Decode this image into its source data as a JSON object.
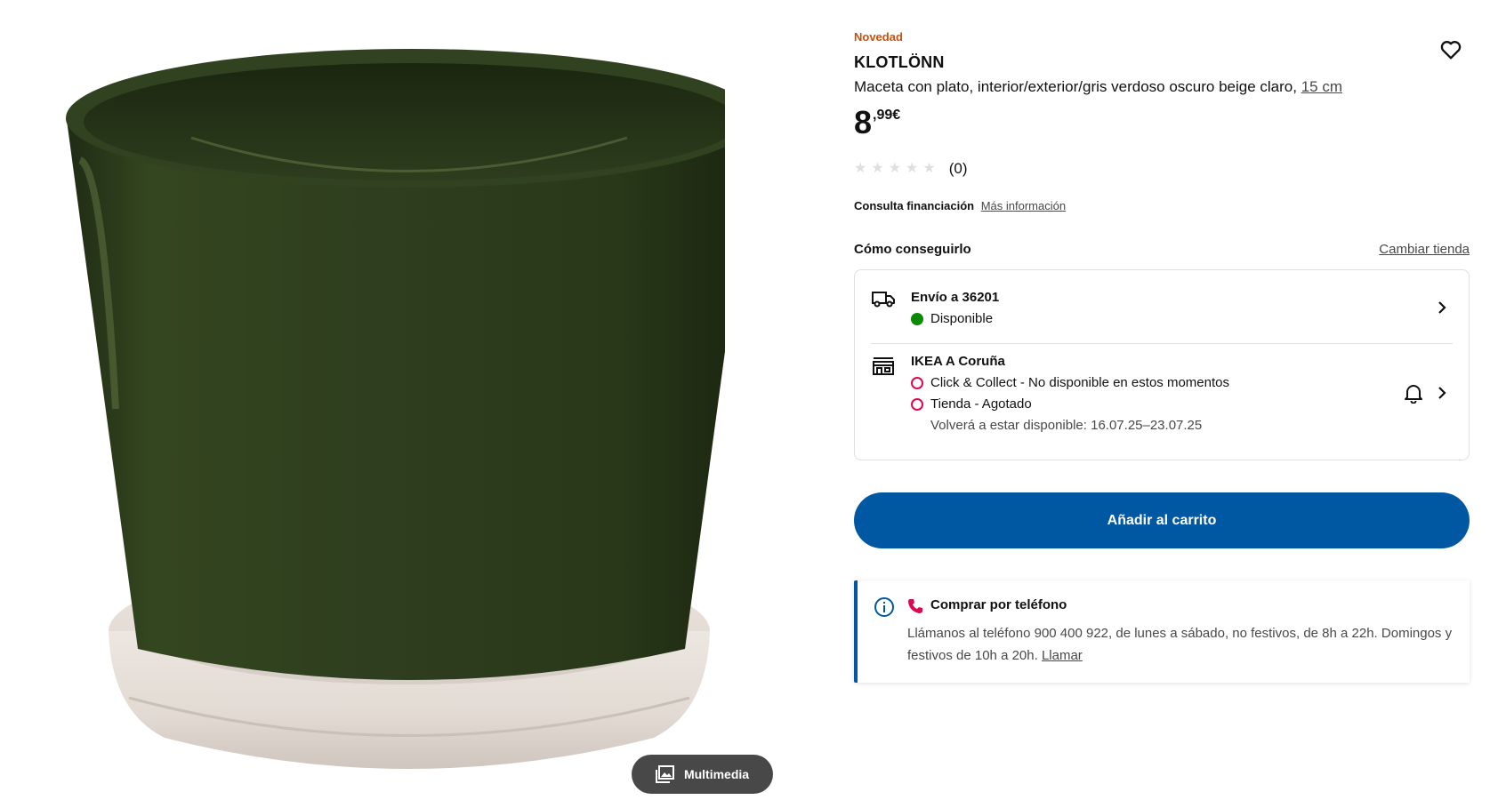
{
  "product": {
    "badge": "Novedad",
    "name": "KLOTLÖNN",
    "description": "Maceta con plato, interior/exterior/gris verdoso oscuro beige claro,",
    "size_link": "15 cm",
    "price_integer": "8",
    "price_decimal": ",99€",
    "rating_count": "(0)",
    "rating_stars": 0
  },
  "media": {
    "multimedia_label": "Multimedia"
  },
  "finance": {
    "label": "Consulta financiación",
    "link": "Más información"
  },
  "availability": {
    "title": "Cómo conseguirlo",
    "change_store": "Cambiar tienda",
    "delivery": {
      "title": "Envío a 36201",
      "status": "Disponible"
    },
    "store": {
      "title": "IKEA A Coruña",
      "click_collect": "Click & Collect - No disponible en estos momentos",
      "in_store": "Tienda - Agotado",
      "restock": "Volverá a estar disponible: 16.07.25–23.07.25"
    }
  },
  "cart": {
    "add_label": "Añadir al carrito"
  },
  "phone": {
    "title": "Comprar por teléfono",
    "text": "Llámanos al teléfono 900 400 922, de lunes a sábado, no festivos, de 8h a 22h. Domingos y festivos de 10h a 20h.",
    "call_link": "Llamar"
  },
  "colors": {
    "primary": "#0058a3",
    "badge": "#ca5008",
    "available": "#0a8a00",
    "unavailable": "#e00751",
    "pot_green": "#2c3b1f",
    "saucer_beige": "#e6dfd8"
  }
}
